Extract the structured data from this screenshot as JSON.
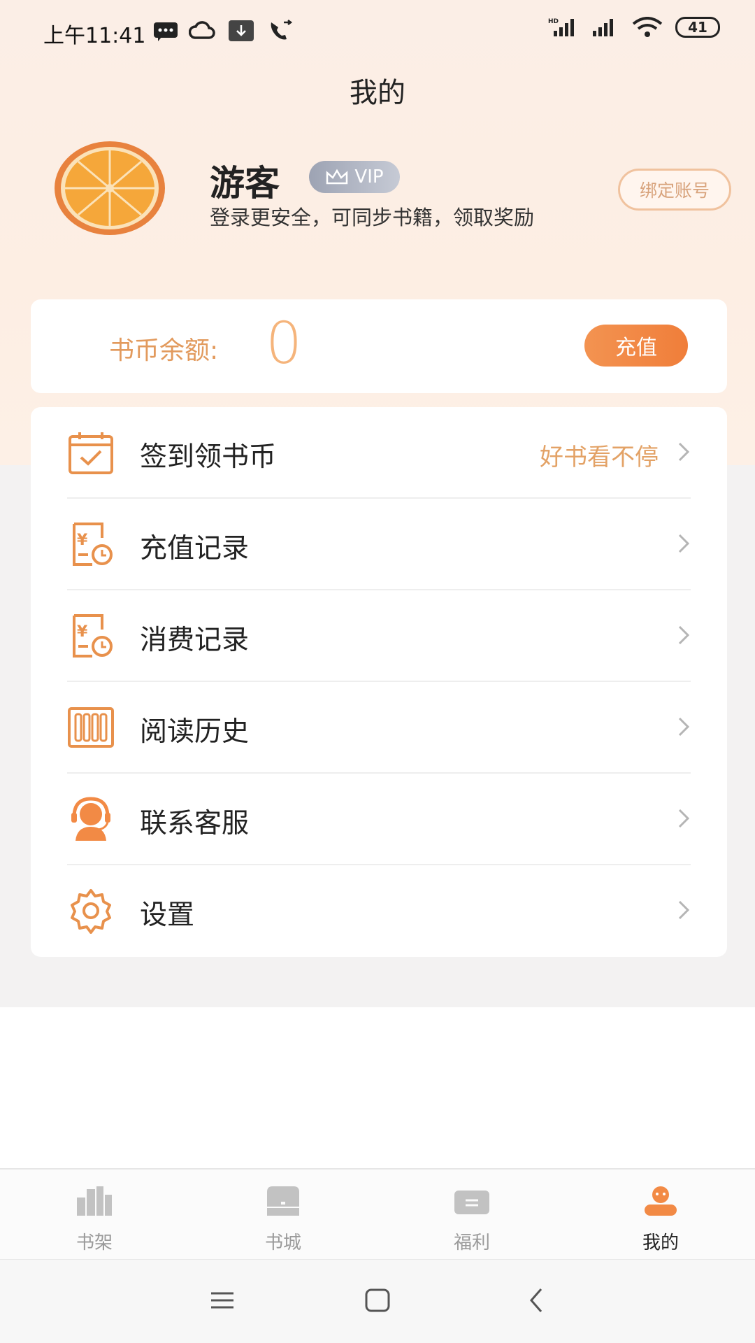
{
  "status_bar": {
    "time": "上午11:41",
    "battery": "41",
    "icons": [
      "message-icon",
      "cloud-icon",
      "download-icon",
      "call-forward-icon",
      "hd-signal-icon",
      "signal-icon",
      "wifi-icon",
      "battery-icon"
    ]
  },
  "header": {
    "title": "我的"
  },
  "profile": {
    "name": "游客",
    "vip_label": "VIP",
    "subtitle": "登录更安全，可同步书籍，领取奖励",
    "bind_label": "绑定账号",
    "avatar_icon": "orange-slice-avatar"
  },
  "balance": {
    "label": "书币余额:",
    "value": "0",
    "recharge_label": "充值"
  },
  "menu": {
    "items": [
      {
        "label": "签到领书币",
        "extra": "好书看不停",
        "icon": "calendar-check-icon"
      },
      {
        "label": "充值记录",
        "extra": "",
        "icon": "yen-record-icon"
      },
      {
        "label": "消费记录",
        "extra": "",
        "icon": "yen-record-icon"
      },
      {
        "label": "阅读历史",
        "extra": "",
        "icon": "books-icon"
      },
      {
        "label": "联系客服",
        "extra": "",
        "icon": "customer-service-icon"
      },
      {
        "label": "设置",
        "extra": "",
        "icon": "gear-icon"
      }
    ]
  },
  "tabbar": {
    "tabs": [
      {
        "label": "书架",
        "icon": "bookshelf-icon",
        "active": false
      },
      {
        "label": "书城",
        "icon": "bookstore-icon",
        "active": false
      },
      {
        "label": "福利",
        "icon": "gift-icon",
        "active": false
      },
      {
        "label": "我的",
        "icon": "profile-icon",
        "active": true
      }
    ]
  },
  "colors": {
    "accent": "#f07e3a",
    "accent_light": "#e3a266",
    "vip_gray": "#9da3b3",
    "tab_inactive": "#9a9a9a"
  }
}
